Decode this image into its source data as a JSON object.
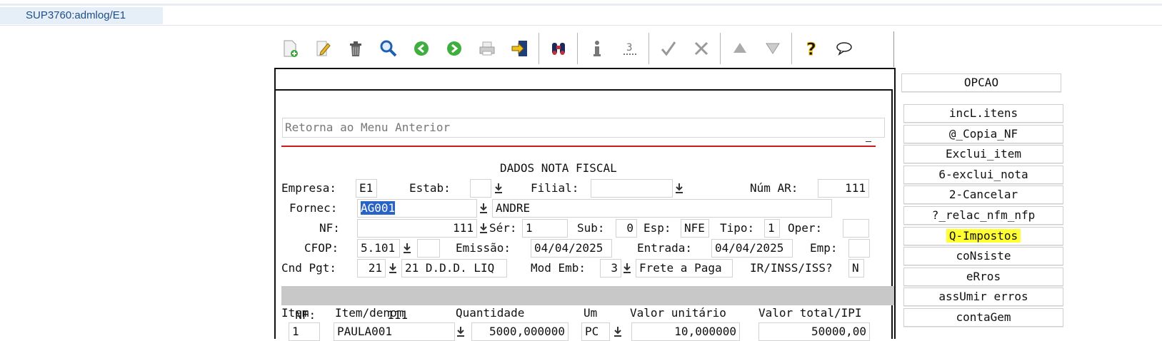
{
  "tab": {
    "title": "SUP3760:admlog/E1"
  },
  "toolbar": {
    "icons": [
      "new-doc-icon",
      "edit-icon",
      "trash-icon",
      "search-icon",
      "prev-icon",
      "next-icon",
      "print-icon",
      "exit-icon",
      "binoculars-icon",
      "info-icon",
      "count-icon",
      "check-icon",
      "cancel-icon",
      "up-arrow-icon",
      "down-arrow-icon",
      "help-icon",
      "chat-icon"
    ]
  },
  "message": "Retorna ao Menu Anterior",
  "form": {
    "title": "DADOS NOTA FISCAL",
    "empresa_label": "Empresa:",
    "empresa": "E1",
    "estab_label": "Estab:",
    "estab": "",
    "filial_label": "Filial:",
    "filial": "",
    "numar_label": "Núm AR:",
    "numar": "111",
    "fornec_label": "Fornec:",
    "fornec": "AG001",
    "fornec_name": "ANDRE",
    "nf_label": "NF:",
    "nf": "111",
    "ser_label": "Sér:",
    "ser": "1",
    "sub_label": "Sub:",
    "sub": "0",
    "esp_label": "Esp:",
    "esp": "NFE",
    "tipo_label": "Tipo:",
    "tipo": "1",
    "oper_label": "Oper:",
    "oper": "",
    "cfop_label": "CFOP:",
    "cfop": "5.101",
    "cfop_extra": "",
    "emissao_label": "Emissão:",
    "emissao": "04/04/2025",
    "entrada_label": "Entrada:",
    "entrada": "04/04/2025",
    "emp_label": "Emp:",
    "emp": "",
    "cndpgt_label": "Cnd Pgt:",
    "cndpgt": "21",
    "cndpgt_desc": "21 D.D.D. LIQ",
    "modemb_label": "Mod Emb:",
    "modemb": "3",
    "modemb_desc": "Frete a Paga",
    "irinss_label": "IR/INSS/ISS?",
    "irinss": "N"
  },
  "summary": {
    "label": "NF:",
    "value": "111"
  },
  "items_table": {
    "headers": [
      "Item",
      "Item/denom",
      "Quantidade",
      "Um",
      "Valor unitário",
      "Valor total/IPI"
    ],
    "row": {
      "item": "1",
      "denom": "PAULA001",
      "quantidade": "5000,000000",
      "um": "PC",
      "valor_unitario": "10,000000",
      "valor_total": "50000,00"
    }
  },
  "side_panel": {
    "header": "OPCAO",
    "buttons": [
      "incL.itens",
      "@_Copia_NF",
      "Exclui_item",
      "6-exclui_nota",
      "2-Cancelar",
      "?_relac_nfm_nfp",
      "Q-Impostos",
      "coNsiste",
      "eRros",
      "assUmir erros",
      "contaGem"
    ],
    "highlighted": "Q-Impostos",
    "highlight_color": "#ffff33"
  }
}
